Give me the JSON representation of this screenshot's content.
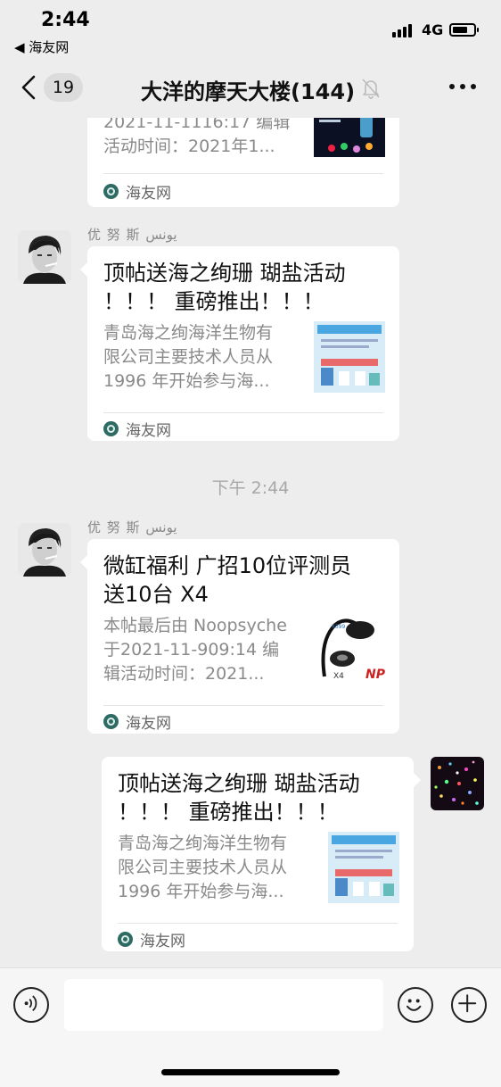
{
  "status_bar": {
    "time": "2:44",
    "back_app": "◀ 海友网",
    "network": "4G"
  },
  "nav": {
    "unread_count": "19",
    "title": "大洋的摩天大楼(144)"
  },
  "messages": [
    {
      "type": "link_card",
      "title": "",
      "desc": "2021-11-1116:17 编辑\n活动时间：2021年1...",
      "source": "海友网"
    },
    {
      "type": "link_card",
      "sender": "优 努 斯 يونس",
      "title": "顶帖送海之绚珊 瑚盐活动\n！！！ 重磅推出！！！",
      "desc": "青岛海之绚海洋生物有\n限公司主要技术人员从\n1996 年开始参与海...",
      "source": "海友网"
    },
    {
      "type": "timestamp",
      "text": "下午 2:44"
    },
    {
      "type": "link_card",
      "sender": "优 努 斯 يونس",
      "title": "微缸福利  广招10位评测员\n 送10台 X4",
      "desc": "本帖最后由 Noopsyche\n于2021-11-909:14 编\n辑活动时间：2021...",
      "source": "海友网"
    },
    {
      "type": "link_card",
      "sender": "self",
      "title": "顶帖送海之绚珊 瑚盐活动\n！！！ 重磅推出！！！",
      "desc": "青岛海之绚海洋生物有\n限公司主要技术人员从\n1996 年开始参与海...",
      "source": "海友网"
    }
  ],
  "thumb_text": {
    "product_code": "X4",
    "brand": "NP"
  },
  "icons": {
    "back": "chevron-left-icon",
    "mute": "bell-slash-icon",
    "more": "ellipsis-icon",
    "voice": "voice-icon",
    "emoji": "smile-icon",
    "plus": "plus-icon"
  }
}
